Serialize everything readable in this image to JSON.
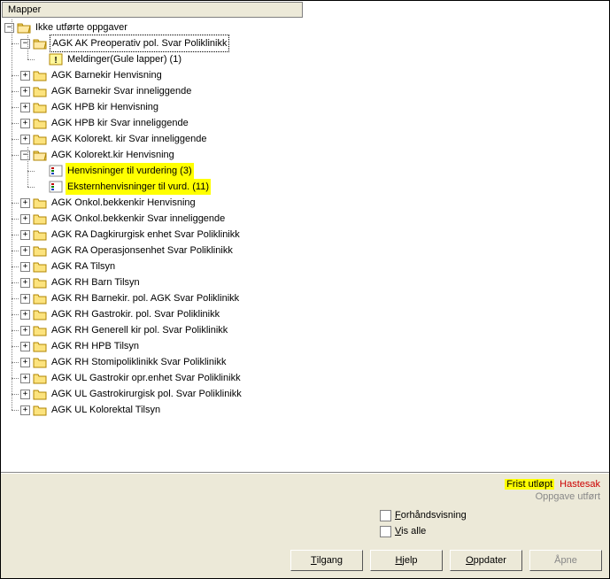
{
  "header": {
    "title": "Mapper"
  },
  "tree": {
    "root": {
      "label": "Ikke utførte oppgaver",
      "expanded": true,
      "children": {
        "agk_preop": {
          "label": "AGK AK Preoperativ pol. Svar Poliklinikk",
          "expanded": true,
          "selected": true,
          "children": {
            "meldinger": {
              "label": "Meldinger(Gule lapper) (1)"
            }
          }
        },
        "barnekir_henv": {
          "label": "AGK Barnekir Henvisning"
        },
        "barnekir_svar": {
          "label": "AGK Barnekir Svar inneliggende"
        },
        "hpb_henv": {
          "label": "AGK HPB kir Henvisning"
        },
        "hpb_svar": {
          "label": "AGK HPB kir Svar inneliggende"
        },
        "kolorekt_svar": {
          "label": "AGK Kolorekt. kir Svar inneliggende"
        },
        "kolorekt_henv": {
          "label": "AGK Kolorekt.kir Henvisning",
          "expanded": true,
          "children": {
            "henv_vurd": {
              "label": "Henvisninger til vurdering (3)",
              "highlight": true
            },
            "ekst_henv": {
              "label": "Eksternhenvisninger til vurd. (11)",
              "highlight": true
            }
          }
        },
        "onkol_henv": {
          "label": "AGK Onkol.bekkenkir Henvisning"
        },
        "onkol_svar": {
          "label": "AGK Onkol.bekkenkir Svar inneliggende"
        },
        "ra_dagkir": {
          "label": "AGK RA Dagkirurgisk enhet Svar Poliklinikk"
        },
        "ra_op": {
          "label": "AGK RA Operasjonsenhet Svar Poliklinikk"
        },
        "ra_tilsyn": {
          "label": "AGK RA Tilsyn"
        },
        "rh_barn": {
          "label": "AGK RH Barn Tilsyn"
        },
        "rh_barnekir": {
          "label": "AGK RH Barnekir. pol. AGK Svar Poliklinikk"
        },
        "rh_gastro": {
          "label": "AGK RH Gastrokir. pol. Svar Poliklinikk"
        },
        "rh_generell": {
          "label": "AGK RH Generell kir pol. Svar Poliklinikk"
        },
        "rh_hpb": {
          "label": "AGK RH HPB Tilsyn"
        },
        "rh_stomi": {
          "label": "AGK RH Stomipoliklinikk Svar Poliklinikk"
        },
        "ul_gastro_opr": {
          "label": "AGK UL Gastrokir opr.enhet Svar Poliklinikk"
        },
        "ul_gastro_pol": {
          "label": "AGK UL Gastrokirurgisk pol. Svar Poliklinikk"
        },
        "ul_kolorektal": {
          "label": "AGK UL Kolorektal Tilsyn"
        }
      }
    }
  },
  "status": {
    "frist": "Frist utløpt",
    "haste": "Hastesak",
    "done": "Oppgave utført"
  },
  "options": {
    "preview": "Forhåndsvisning",
    "show_all": "Vis alle"
  },
  "buttons": {
    "access": {
      "pre": "",
      "u": "T",
      "post": "ilgang"
    },
    "help": {
      "pre": "",
      "u": "H",
      "post": "jelp"
    },
    "refresh": {
      "pre": "",
      "u": "O",
      "post": "ppdater"
    },
    "open": {
      "label": "Åpne"
    }
  }
}
